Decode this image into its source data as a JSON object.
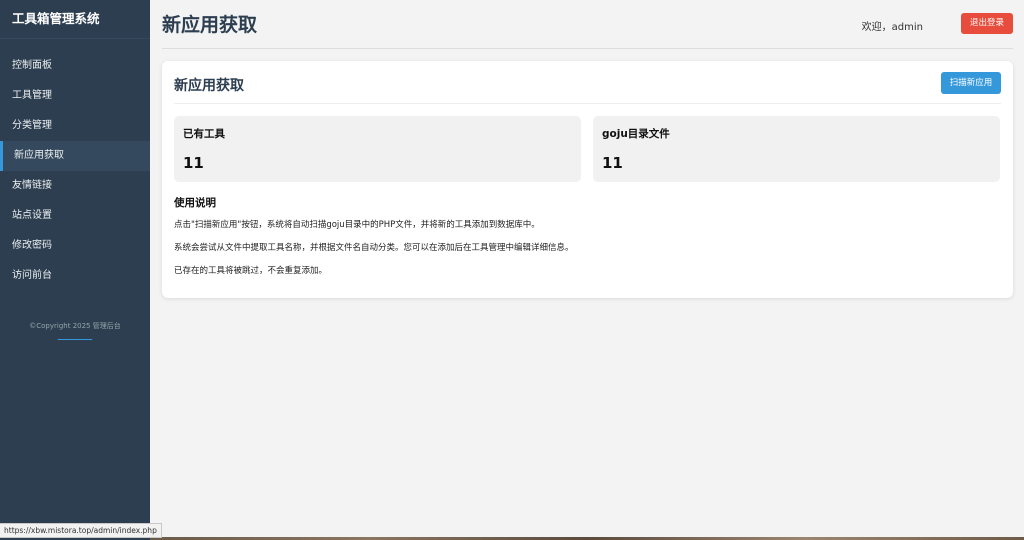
{
  "sidebar": {
    "brand": "工具箱管理系统",
    "items": [
      {
        "label": "控制面板"
      },
      {
        "label": "工具管理"
      },
      {
        "label": "分类管理"
      },
      {
        "label": "新应用获取"
      },
      {
        "label": "友情链接"
      },
      {
        "label": "站点设置"
      },
      {
        "label": "修改密码"
      },
      {
        "label": "访问前台"
      }
    ],
    "active_index": 3,
    "copyright": "©Copyright 2025 管理后台"
  },
  "topbar": {
    "page_title": "新应用获取",
    "welcome": "欢迎，admin",
    "logout_label": "退出登录"
  },
  "card": {
    "title": "新应用获取",
    "scan_button": "扫描新应用",
    "stats": [
      {
        "label": "已有工具",
        "value": "11"
      },
      {
        "label": "goju目录文件",
        "value": "11"
      }
    ],
    "instructions": {
      "title": "使用说明",
      "lines": [
        "点击\"扫描新应用\"按钮，系统将自动扫描goju目录中的PHP文件，并将新的工具添加到数据库中。",
        "系统会尝试从文件中提取工具名称，并根据文件名自动分类。您可以在添加后在工具管理中编辑详细信息。",
        "已存在的工具将被跳过，不会重复添加。"
      ]
    }
  },
  "status_bar": {
    "url": "https://xbw.mistora.top/admin/index.php"
  },
  "colors": {
    "sidebar_bg": "#2c3e50",
    "accent": "#3498db",
    "danger": "#e74c3c"
  }
}
